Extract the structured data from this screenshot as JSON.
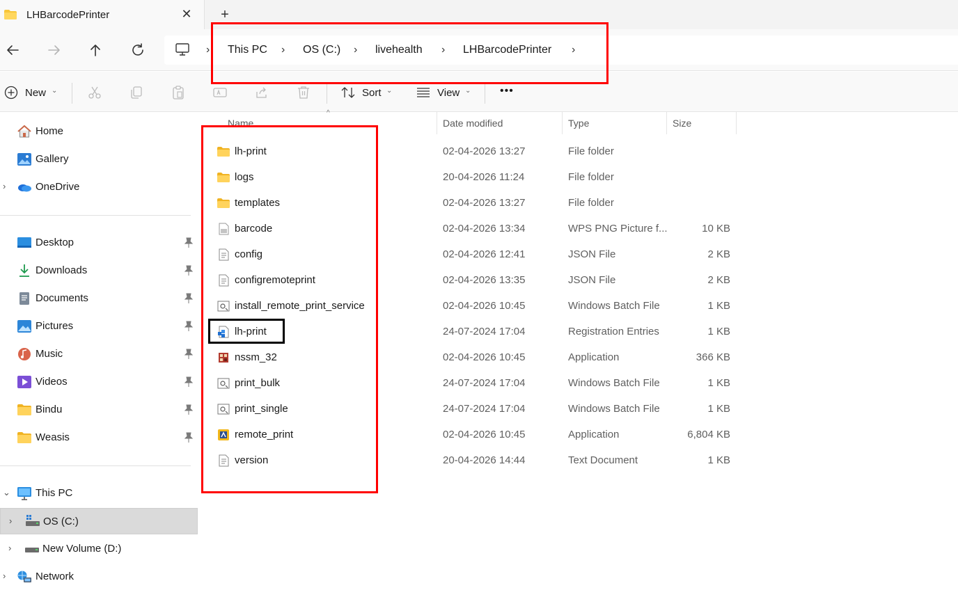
{
  "window": {
    "tab_title": "LHBarcodePrinter",
    "close_glyph": "✕",
    "new_tab_glyph": "+"
  },
  "navigation": {
    "back_icon": "arrow-left-icon",
    "forward_icon": "arrow-right-icon",
    "up_icon": "arrow-up-icon",
    "refresh_icon": "refresh-icon",
    "breadcrumb": [
      "This PC",
      "OS (C:)",
      "livehealth",
      "LHBarcodePrinter"
    ],
    "separator": "›"
  },
  "commandbar": {
    "new_label": "New",
    "sort_label": "Sort",
    "view_label": "View",
    "more_label": "•••"
  },
  "sidebar": {
    "quick": [
      {
        "label": "Home",
        "icon": "home-icon"
      },
      {
        "label": "Gallery",
        "icon": "gallery-icon"
      },
      {
        "label": "OneDrive",
        "icon": "onedrive-icon",
        "expandable": true
      }
    ],
    "pinned": [
      {
        "label": "Desktop",
        "icon": "desktop-icon"
      },
      {
        "label": "Downloads",
        "icon": "downloads-icon"
      },
      {
        "label": "Documents",
        "icon": "documents-icon"
      },
      {
        "label": "Pictures",
        "icon": "pictures-icon"
      },
      {
        "label": "Music",
        "icon": "music-icon"
      },
      {
        "label": "Videos",
        "icon": "videos-icon"
      },
      {
        "label": "Bindu",
        "icon": "folder-icon"
      },
      {
        "label": "Weasis",
        "icon": "folder-icon"
      }
    ],
    "devices": [
      {
        "label": "This PC",
        "icon": "this-pc-icon",
        "expanded": true
      },
      {
        "label": "OS (C:)",
        "icon": "drive-icon",
        "selected": true
      },
      {
        "label": "New Volume (D:)",
        "icon": "drive-icon"
      },
      {
        "label": "Network",
        "icon": "network-icon"
      }
    ]
  },
  "filelist": {
    "columns": {
      "name": "Name",
      "date": "Date modified",
      "type": "Type",
      "size": "Size"
    },
    "sort_indicator": "^",
    "files": [
      {
        "name": "lh-print",
        "date": "02-04-2026 13:27",
        "type": "File folder",
        "size": "",
        "icon": "folder-icon"
      },
      {
        "name": "logs",
        "date": "20-04-2026 11:24",
        "type": "File folder",
        "size": "",
        "icon": "folder-icon"
      },
      {
        "name": "templates",
        "date": "02-04-2026 13:27",
        "type": "File folder",
        "size": "",
        "icon": "folder-icon"
      },
      {
        "name": "barcode",
        "date": "02-04-2026 13:34",
        "type": "WPS PNG Picture f...",
        "size": "10 KB",
        "icon": "png-file-icon"
      },
      {
        "name": "config",
        "date": "02-04-2026 12:41",
        "type": "JSON File",
        "size": "2 KB",
        "icon": "json-file-icon"
      },
      {
        "name": "configremoteprint",
        "date": "02-04-2026 13:35",
        "type": "JSON File",
        "size": "2 KB",
        "icon": "json-file-icon"
      },
      {
        "name": "install_remote_print_service",
        "date": "02-04-2026 10:45",
        "type": "Windows Batch File",
        "size": "1 KB",
        "icon": "batch-file-icon"
      },
      {
        "name": "lh-print",
        "date": "24-07-2024 17:04",
        "type": "Registration Entries",
        "size": "1 KB",
        "icon": "registry-file-icon"
      },
      {
        "name": "nssm_32",
        "date": "02-04-2026 10:45",
        "type": "Application",
        "size": "366 KB",
        "icon": "nssm-app-icon"
      },
      {
        "name": "print_bulk",
        "date": "24-07-2024 17:04",
        "type": "Windows Batch File",
        "size": "1 KB",
        "icon": "batch-file-icon"
      },
      {
        "name": "print_single",
        "date": "24-07-2024 17:04",
        "type": "Windows Batch File",
        "size": "1 KB",
        "icon": "batch-file-icon"
      },
      {
        "name": "remote_print",
        "date": "02-04-2026 10:45",
        "type": "Application",
        "size": "6,804 KB",
        "icon": "remote-print-app-icon"
      },
      {
        "name": "version",
        "date": "20-04-2026 14:44",
        "type": "Text Document",
        "size": "1 KB",
        "icon": "text-file-icon"
      }
    ]
  },
  "colors": {
    "annotation_red": "#ff0000",
    "annotation_black": "#000000",
    "folder_yellow": "#f8c63a",
    "selection_gray": "#dadada"
  }
}
